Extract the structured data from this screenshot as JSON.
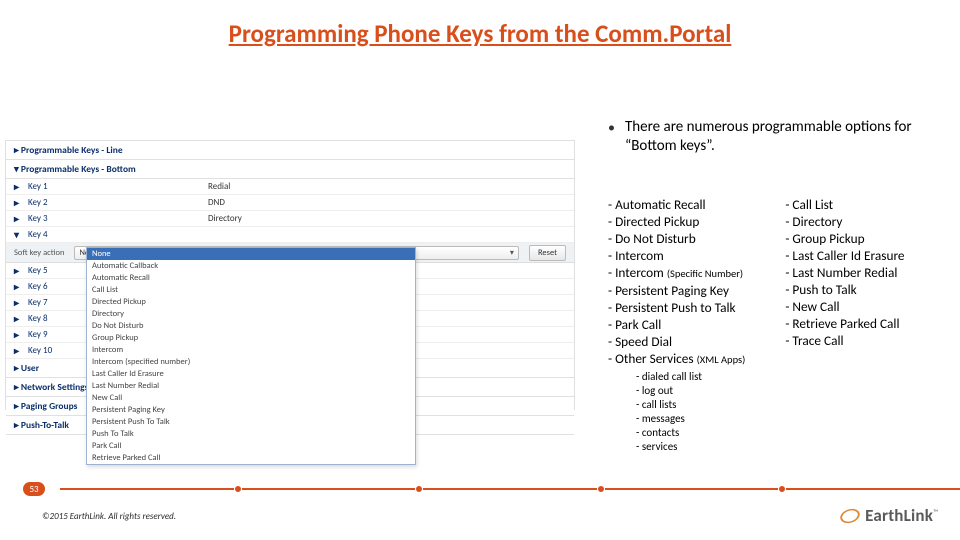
{
  "title": "Programming Phone Keys from the Comm.Portal",
  "bullet": "There are numerous programmable options for “Bottom keys”.",
  "options_col1": [
    {
      "t": "- Automatic Recall"
    },
    {
      "t": "- Directed Pickup"
    },
    {
      "t": "- Do Not Disturb"
    },
    {
      "t": "- Intercom"
    },
    {
      "t": "- Intercom ",
      "sm": "(Specific Number)"
    },
    {
      "t": "- Persistent Paging Key"
    },
    {
      "t": "- Persistent Push to Talk"
    },
    {
      "t": "- Park Call"
    },
    {
      "t": "- Speed Dial"
    },
    {
      "t": "- Other Services ",
      "sm": "(XML Apps)"
    }
  ],
  "sub_services": [
    "- dialed call list",
    "- log out",
    "- call lists",
    "- messages",
    "- contacts",
    "- services"
  ],
  "options_col2": [
    "- Call List",
    "- Directory",
    "- Group Pickup",
    "- Last Caller Id Erasure",
    "- Last Number Redial",
    "- Push to Talk",
    "- New Call",
    "- Retrieve Parked Call",
    "- Trace Call"
  ],
  "screenshot": {
    "section1": "Programmable Keys - Line",
    "section2": "Programmable Keys - Bottom",
    "keys": [
      {
        "exp": "▸",
        "label": "Key 1",
        "val": "Redial"
      },
      {
        "exp": "▸",
        "label": "Key 2",
        "val": "DND"
      },
      {
        "exp": "▸",
        "label": "Key 3",
        "val": "Directory"
      },
      {
        "exp": "▾",
        "label": "Key 4",
        "val": ""
      }
    ],
    "softaction_label": "Soft key action",
    "softaction_value": "None",
    "reset": "Reset",
    "keys_rest": [
      {
        "exp": "▸",
        "label": "Key 5",
        "val": ""
      },
      {
        "exp": "▸",
        "label": "Key 6",
        "val": ""
      },
      {
        "exp": "▸",
        "label": "Key 7",
        "val": ""
      },
      {
        "exp": "▸",
        "label": "Key 8",
        "val": ""
      },
      {
        "exp": "▸",
        "label": "Key 9",
        "val": ""
      },
      {
        "exp": "▸",
        "label": "Key 10",
        "val": ""
      }
    ],
    "footer_sections": [
      "User",
      "Network Settings",
      "Paging Groups",
      "Push-To-Talk"
    ],
    "dropdown": [
      "None",
      "Automatic Callback",
      "Automatic Recall",
      "Call List",
      "Directed Pickup",
      "Directory",
      "Do Not Disturb",
      "Group Pickup",
      "Intercom",
      "Intercom (specified number)",
      "Last Caller Id Erasure",
      "Last Number Redial",
      "New Call",
      "Persistent Paging Key",
      "Persistent Push To Talk",
      "Push To Talk",
      "Park Call",
      "Retrieve Parked Call"
    ],
    "dropdown_hl_index": 0
  },
  "page_number": "53",
  "copyright": "©2015 EarthLink. All rights reserved.",
  "logo_text": "EarthLink",
  "logo_tm": "™"
}
